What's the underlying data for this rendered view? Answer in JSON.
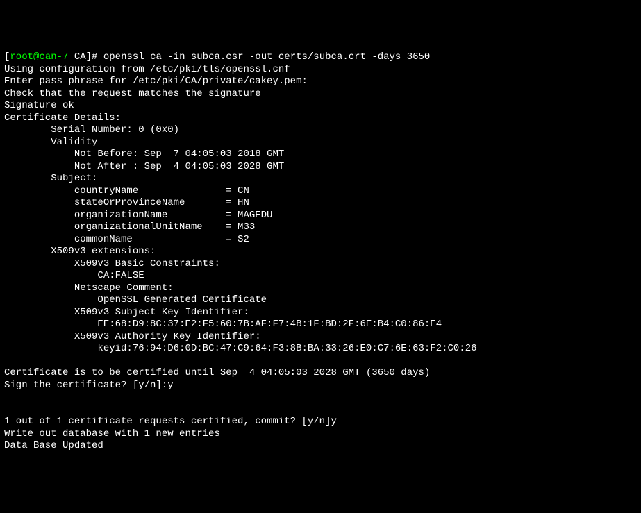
{
  "prompt": {
    "bracket_open": "[",
    "user_host": "root@can-7",
    "dir": " CA",
    "bracket_close": "]# ",
    "command": "openssl ca -in subca.csr -out certs/subca.crt -days 3650"
  },
  "lines": {
    "config": "Using configuration from /etc/pki/tls/openssl.cnf",
    "passphrase": "Enter pass phrase for /etc/pki/CA/private/cakey.pem:",
    "check": "Check that the request matches the signature",
    "sig_ok": "Signature ok",
    "cert_details": "Certificate Details:",
    "serial": "        Serial Number: 0 (0x0)",
    "validity": "        Validity",
    "not_before": "            Not Before: Sep  7 04:05:03 2018 GMT",
    "not_after": "            Not After : Sep  4 04:05:03 2028 GMT",
    "subject": "        Subject:",
    "country": "            countryName               = CN",
    "state": "            stateOrProvinceName       = HN",
    "org": "            organizationName          = MAGEDU",
    "ou": "            organizationalUnitName    = M33",
    "cn": "            commonName                = S2",
    "x509_ext": "        X509v3 extensions:",
    "basic_constraints_hdr": "            X509v3 Basic Constraints: ",
    "ca_false": "                CA:FALSE",
    "netscape_hdr": "            Netscape Comment: ",
    "netscape_val": "                OpenSSL Generated Certificate",
    "subj_key_hdr": "            X509v3 Subject Key Identifier: ",
    "subj_key_val": "                EE:68:D9:8C:37:E2:F5:60:7B:AF:F7:4B:1F:BD:2F:6E:B4:C0:86:E4",
    "auth_key_hdr": "            X509v3 Authority Key Identifier: ",
    "auth_key_val": "                keyid:76:94:D6:0D:BC:47:C9:64:F3:8B:BA:33:26:E0:C7:6E:63:F2:C0:26",
    "blank1": "",
    "certified_until": "Certificate is to be certified until Sep  4 04:05:03 2028 GMT (3650 days)",
    "sign_prompt": "Sign the certificate? [y/n]:y",
    "blank2": "",
    "blank3": "",
    "commit_prompt": "1 out of 1 certificate requests certified, commit? [y/n]y",
    "write_db": "Write out database with 1 new entries",
    "db_updated": "Data Base Updated"
  }
}
